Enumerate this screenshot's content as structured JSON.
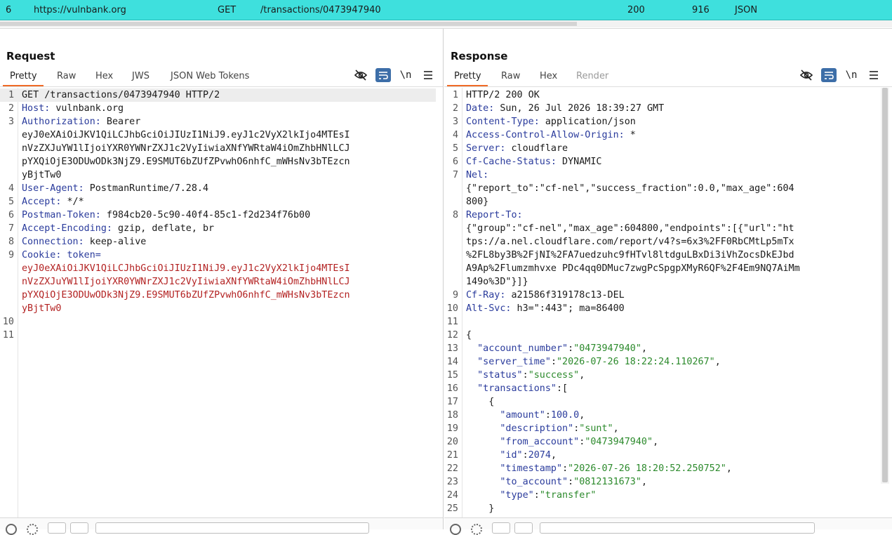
{
  "history_row": {
    "id": "6",
    "host": "https://vulnbank.org",
    "method": "GET",
    "url": "/transactions/0473947940",
    "status": "200",
    "length": "916",
    "mime": "JSON"
  },
  "layout_buttons": [
    "split-columns-icon",
    "split-rows-icon",
    "single-pane-icon"
  ],
  "request": {
    "title": "Request",
    "tabs": [
      "Pretty",
      "Raw",
      "Hex",
      "JWS",
      "JSON Web Tokens"
    ],
    "active_tab": "Pretty",
    "toolbar_icons": [
      "eye-slash-icon",
      "wrap-icon",
      "newline-icon",
      "menu-icon"
    ],
    "newline_label": "\\n",
    "lines": [
      {
        "n": "1",
        "segs": [
          [
            "GET /transactions/0473947940 HTTP/2",
            "plain"
          ]
        ]
      },
      {
        "n": "2",
        "segs": [
          [
            "Host:",
            "hname"
          ],
          [
            " vulnbank.org",
            "plain"
          ]
        ]
      },
      {
        "n": "3",
        "segs": [
          [
            "Authorization:",
            "hname"
          ],
          [
            " Bearer",
            "plain"
          ]
        ]
      },
      {
        "n": "",
        "segs": [
          [
            "eyJ0eXAiOiJKV1QiLCJhbGciOiJIUzI1NiJ9.eyJ1c2VyX2lkIjo4MTEsI",
            "plain"
          ]
        ]
      },
      {
        "n": "",
        "segs": [
          [
            "nVzZXJuYW1lIjoiYXR0YWNrZXJ1c2VyIiwiaXNfYWRtaW4iOmZhbHNlLCJ",
            "plain"
          ]
        ]
      },
      {
        "n": "",
        "segs": [
          [
            "pYXQiOjE3ODUwODk3NjZ9.E9SMUT6bZUfZPvwhO6nhfC_mWHsNv3bTEzcn",
            "plain"
          ]
        ]
      },
      {
        "n": "",
        "segs": [
          [
            "yBjtTw0",
            "plain"
          ]
        ]
      },
      {
        "n": "4",
        "segs": [
          [
            "User-Agent:",
            "hname"
          ],
          [
            " PostmanRuntime/7.28.4",
            "plain"
          ]
        ]
      },
      {
        "n": "5",
        "segs": [
          [
            "Accept:",
            "hname"
          ],
          [
            " */*",
            "plain"
          ]
        ]
      },
      {
        "n": "6",
        "segs": [
          [
            "Postman-Token:",
            "hname"
          ],
          [
            " f984cb20-5c90-40f4-85c1-f2d234f76b00",
            "plain"
          ]
        ]
      },
      {
        "n": "7",
        "segs": [
          [
            "Accept-Encoding:",
            "hname"
          ],
          [
            " gzip, deflate, br",
            "plain"
          ]
        ]
      },
      {
        "n": "8",
        "segs": [
          [
            "Connection:",
            "hname"
          ],
          [
            " keep-alive",
            "plain"
          ]
        ]
      },
      {
        "n": "9",
        "segs": [
          [
            "Cookie:",
            "hname"
          ],
          [
            " token=",
            "hname"
          ]
        ]
      },
      {
        "n": "",
        "segs": [
          [
            "eyJ0eXAiOiJKV1QiLCJhbGciOiJIUzI1NiJ9.eyJ1c2VyX2lkIjo4MTEsI",
            "tok"
          ]
        ]
      },
      {
        "n": "",
        "segs": [
          [
            "nVzZXJuYW1lIjoiYXR0YWNrZXJ1c2VyIiwiaXNfYWRtaW4iOmZhbHNlLCJ",
            "tok"
          ]
        ]
      },
      {
        "n": "",
        "segs": [
          [
            "pYXQiOjE3ODUwODk3NjZ9.E9SMUT6bZUfZPvwhO6nhfC_mWHsNv3bTEzcn",
            "tok"
          ]
        ]
      },
      {
        "n": "",
        "segs": [
          [
            "yBjtTw0",
            "tok"
          ]
        ]
      },
      {
        "n": "10",
        "segs": []
      },
      {
        "n": "11",
        "segs": []
      }
    ]
  },
  "response": {
    "title": "Response",
    "tabs": [
      "Pretty",
      "Raw",
      "Hex",
      "Render"
    ],
    "active_tab": "Pretty",
    "disabled_tab": "Render",
    "toolbar_icons": [
      "eye-slash-icon",
      "wrap-icon",
      "newline-icon",
      "menu-icon"
    ],
    "newline_label": "\\n",
    "lines": [
      {
        "n": "1",
        "segs": [
          [
            "HTTP/2 200 OK",
            "plain"
          ]
        ]
      },
      {
        "n": "2",
        "segs": [
          [
            "Date:",
            "hname"
          ],
          [
            " Sun, 26 Jul 2026 18:39:27 GMT",
            "plain"
          ]
        ]
      },
      {
        "n": "3",
        "segs": [
          [
            "Content-Type:",
            "hname"
          ],
          [
            " application/json",
            "plain"
          ]
        ]
      },
      {
        "n": "4",
        "segs": [
          [
            "Access-Control-Allow-Origin:",
            "hname"
          ],
          [
            " *",
            "plain"
          ]
        ]
      },
      {
        "n": "5",
        "segs": [
          [
            "Server:",
            "hname"
          ],
          [
            " cloudflare",
            "plain"
          ]
        ]
      },
      {
        "n": "6",
        "segs": [
          [
            "Cf-Cache-Status:",
            "hname"
          ],
          [
            " DYNAMIC",
            "plain"
          ]
        ]
      },
      {
        "n": "7",
        "segs": [
          [
            "Nel:",
            "hname"
          ]
        ]
      },
      {
        "n": "",
        "segs": [
          [
            "{\"report_to\":\"cf-nel\",\"success_fraction\":0.0,\"max_age\":604",
            "plain"
          ]
        ]
      },
      {
        "n": "",
        "segs": [
          [
            "800}",
            "plain"
          ]
        ]
      },
      {
        "n": "8",
        "segs": [
          [
            "Report-To:",
            "hname"
          ]
        ]
      },
      {
        "n": "",
        "segs": [
          [
            "{\"group\":\"cf-nel\",\"max_age\":604800,\"endpoints\":[{\"url\":\"ht",
            "plain"
          ]
        ]
      },
      {
        "n": "",
        "segs": [
          [
            "tps://a.nel.cloudflare.com/report/v4?s=6x3%2FF0RbCMtLp5mTx",
            "plain"
          ]
        ]
      },
      {
        "n": "",
        "segs": [
          [
            "%2FL8by3B%2FjNI%2FA7uedzuhc9fHTvl8ltdguLBxDi3iVhZocsDkEJbd",
            "plain"
          ]
        ]
      },
      {
        "n": "",
        "segs": [
          [
            "A9Ap%2Flumzmhvxe PDc4qq0DMuc7zwgPcSpgpXMyR6QF%2F4Em9NQ7AiMm",
            "plain"
          ]
        ]
      },
      {
        "n": "",
        "segs": [
          [
            "149o%3D\"}]}",
            "plain"
          ]
        ]
      },
      {
        "n": "9",
        "segs": [
          [
            "Cf-Ray:",
            "hname"
          ],
          [
            " a21586f319178c13-DEL",
            "plain"
          ]
        ]
      },
      {
        "n": "10",
        "segs": [
          [
            "Alt-Svc:",
            "hname"
          ],
          [
            " h3=\":443\"; ma=86400",
            "plain"
          ]
        ]
      },
      {
        "n": "11",
        "segs": []
      },
      {
        "n": "12",
        "segs": [
          [
            "{",
            "jpunc"
          ]
        ]
      },
      {
        "n": "13",
        "segs": [
          [
            "  ",
            "plain"
          ],
          [
            "\"account_number\"",
            "jkey"
          ],
          [
            ":",
            "jpunc"
          ],
          [
            "\"0473947940\"",
            "jstr"
          ],
          [
            ",",
            "jpunc"
          ]
        ]
      },
      {
        "n": "14",
        "segs": [
          [
            "  ",
            "plain"
          ],
          [
            "\"server_time\"",
            "jkey"
          ],
          [
            ":",
            "jpunc"
          ],
          [
            "\"2026-07-26 18:22:24.110267\"",
            "jstr"
          ],
          [
            ",",
            "jpunc"
          ]
        ]
      },
      {
        "n": "15",
        "segs": [
          [
            "  ",
            "plain"
          ],
          [
            "\"status\"",
            "jkey"
          ],
          [
            ":",
            "jpunc"
          ],
          [
            "\"success\"",
            "jstr"
          ],
          [
            ",",
            "jpunc"
          ]
        ]
      },
      {
        "n": "16",
        "segs": [
          [
            "  ",
            "plain"
          ],
          [
            "\"transactions\"",
            "jkey"
          ],
          [
            ":[",
            "jpunc"
          ]
        ]
      },
      {
        "n": "17",
        "segs": [
          [
            "    {",
            "jpunc"
          ]
        ]
      },
      {
        "n": "18",
        "segs": [
          [
            "      ",
            "plain"
          ],
          [
            "\"amount\"",
            "jkey"
          ],
          [
            ":",
            "jpunc"
          ],
          [
            "100.0",
            "jnum"
          ],
          [
            ",",
            "jpunc"
          ]
        ]
      },
      {
        "n": "19",
        "segs": [
          [
            "      ",
            "plain"
          ],
          [
            "\"description\"",
            "jkey"
          ],
          [
            ":",
            "jpunc"
          ],
          [
            "\"sunt\"",
            "jstr"
          ],
          [
            ",",
            "jpunc"
          ]
        ]
      },
      {
        "n": "20",
        "segs": [
          [
            "      ",
            "plain"
          ],
          [
            "\"from_account\"",
            "jkey"
          ],
          [
            ":",
            "jpunc"
          ],
          [
            "\"0473947940\"",
            "jstr"
          ],
          [
            ",",
            "jpunc"
          ]
        ]
      },
      {
        "n": "21",
        "segs": [
          [
            "      ",
            "plain"
          ],
          [
            "\"id\"",
            "jkey"
          ],
          [
            ":",
            "jpunc"
          ],
          [
            "2074",
            "jnum"
          ],
          [
            ",",
            "jpunc"
          ]
        ]
      },
      {
        "n": "22",
        "segs": [
          [
            "      ",
            "plain"
          ],
          [
            "\"timestamp\"",
            "jkey"
          ],
          [
            ":",
            "jpunc"
          ],
          [
            "\"2026-07-26 18:20:52.250752\"",
            "jstr"
          ],
          [
            ",",
            "jpunc"
          ]
        ]
      },
      {
        "n": "23",
        "segs": [
          [
            "      ",
            "plain"
          ],
          [
            "\"to_account\"",
            "jkey"
          ],
          [
            ":",
            "jpunc"
          ],
          [
            "\"0812131673\"",
            "jstr"
          ],
          [
            ",",
            "jpunc"
          ]
        ]
      },
      {
        "n": "24",
        "segs": [
          [
            "      ",
            "plain"
          ],
          [
            "\"type\"",
            "jkey"
          ],
          [
            ":",
            "jpunc"
          ],
          [
            "\"transfer\"",
            "jstr"
          ]
        ]
      },
      {
        "n": "25",
        "segs": [
          [
            "    }",
            "jpunc"
          ]
        ]
      }
    ]
  },
  "colors": {
    "history_highlight": "#3ee0dd",
    "tab_underline": "#f06a26",
    "toggle_active": "#3d6ea8",
    "header_name": "#2a3b9c",
    "token": "#b32222",
    "json_string": "#2c8a2c"
  }
}
